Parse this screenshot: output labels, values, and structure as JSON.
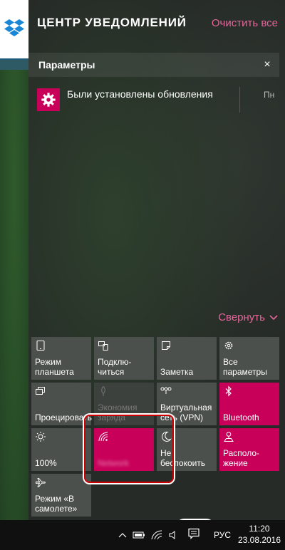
{
  "header": {
    "title": "ЦЕНТР УВЕДОМЛЕНИЙ",
    "clear_all": "Очистить все"
  },
  "notification_group": {
    "title": "Параметры",
    "close_glyph": "×",
    "items": [
      {
        "text": "Были установлены обновления",
        "time": "Пн"
      }
    ]
  },
  "collapse_label": "Свернуть",
  "quick_actions": [
    {
      "label": "Режим планшета",
      "icon": "tablet-mode-icon",
      "state": "off"
    },
    {
      "label": "Подклю-читься",
      "icon": "connect-icon",
      "state": "off"
    },
    {
      "label": "Заметка",
      "icon": "note-icon",
      "state": "off"
    },
    {
      "label": "Все параметры",
      "icon": "gear-icon",
      "state": "off"
    },
    {
      "label": "Проецировать",
      "icon": "project-icon",
      "state": "off"
    },
    {
      "label": "Экономия заряда",
      "icon": "battery-saver-icon",
      "state": "disabled"
    },
    {
      "label": "Виртуальная сеть (VPN)",
      "icon": "vpn-icon",
      "state": "off"
    },
    {
      "label": "Bluetooth",
      "icon": "bluetooth-icon",
      "state": "on"
    },
    {
      "label": "100%",
      "icon": "brightness-icon",
      "state": "off"
    },
    {
      "label": "Network",
      "icon": "wifi-icon",
      "state": "on"
    },
    {
      "label": "Не беспокоить",
      "icon": "moon-icon",
      "state": "off"
    },
    {
      "label": "Располо-жение",
      "icon": "location-icon",
      "state": "on"
    },
    {
      "label": "Режим «В самолете»",
      "icon": "airplane-icon",
      "state": "off"
    }
  ],
  "taskbar": {
    "language": "РУС",
    "time": "11:20",
    "date": "23.08.2016"
  },
  "colors": {
    "accent": "#c8005a",
    "link": "#e5659a",
    "annotation": "#d10000"
  }
}
